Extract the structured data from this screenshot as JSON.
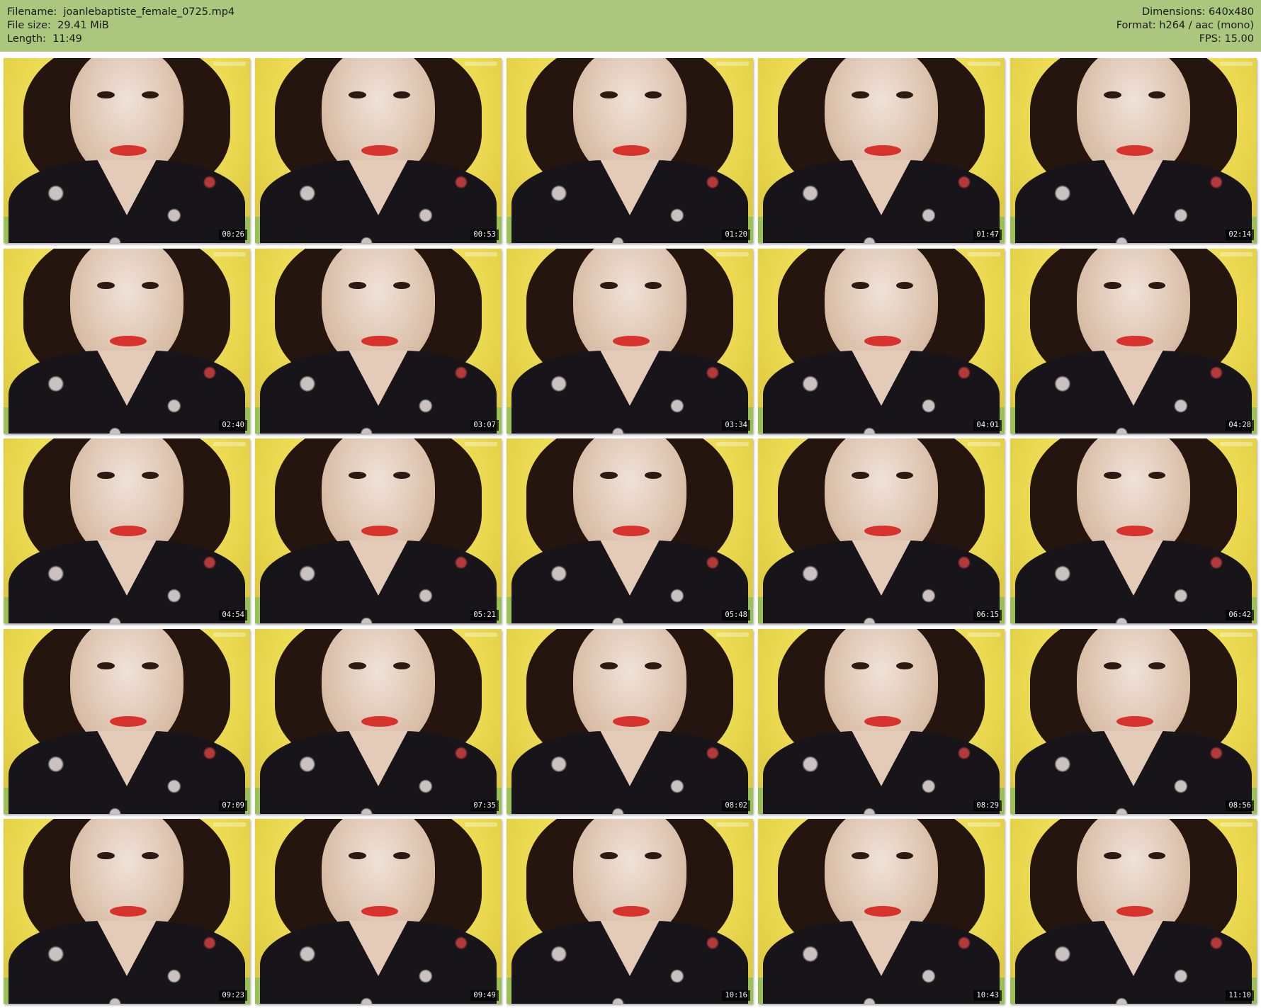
{
  "header": {
    "left": [
      "Filename:  joanlebaptiste_female_0725.mp4",
      "File size:  29.41 MiB",
      "Length:  11:49"
    ],
    "right": [
      "Dimensions: 640x480",
      "Format: h264 / aac (mono)",
      "FPS: 15.00"
    ]
  },
  "colors": {
    "header_bg": "#abc77e",
    "background": "#ffffff"
  },
  "thumbnails": [
    [
      "00:26",
      "00:53",
      "01:20",
      "01:47",
      "02:14"
    ],
    [
      "02:40",
      "03:07",
      "03:34",
      "04:01",
      "04:28"
    ],
    [
      "04:54",
      "05:21",
      "05:48",
      "06:15",
      "06:42"
    ],
    [
      "07:09",
      "07:35",
      "08:02",
      "08:29",
      "08:56"
    ],
    [
      "09:23",
      "09:49",
      "10:16",
      "10:43",
      "11:10"
    ]
  ]
}
